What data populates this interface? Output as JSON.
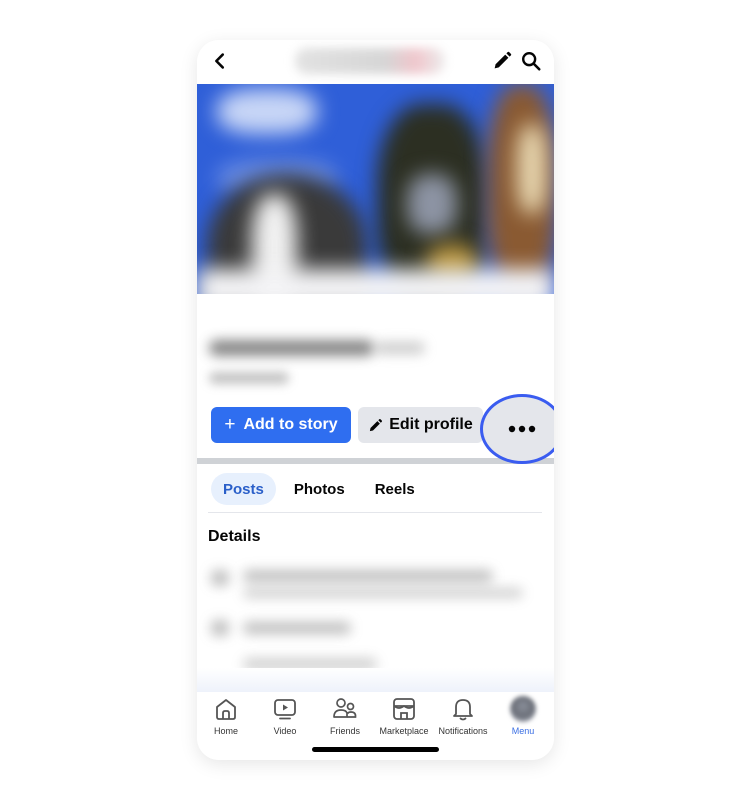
{
  "topbar": {
    "back_icon": "chevron-left-icon",
    "title": "",
    "edit_icon": "pencil-icon",
    "search_icon": "search-icon"
  },
  "profile": {
    "name": "",
    "subtitle": ""
  },
  "actions": {
    "add_to_story_label": "Add to story",
    "add_to_story_icon": "plus-icon",
    "edit_profile_label": "Edit profile",
    "edit_profile_icon": "pencil-icon",
    "more_icon": "more-horizontal-icon",
    "highlight_color": "#3a5cf0",
    "primary_color": "#2f6ef0"
  },
  "tabs": [
    {
      "label": "Posts",
      "active": true
    },
    {
      "label": "Photos",
      "active": false
    },
    {
      "label": "Reels",
      "active": false
    }
  ],
  "details": {
    "title": "Details"
  },
  "bottom_nav": [
    {
      "label": "Home",
      "icon": "home-icon",
      "active": false
    },
    {
      "label": "Video",
      "icon": "video-icon",
      "active": false
    },
    {
      "label": "Friends",
      "icon": "friends-icon",
      "active": false
    },
    {
      "label": "Marketplace",
      "icon": "marketplace-icon",
      "active": false
    },
    {
      "label": "Notifications",
      "icon": "bell-icon",
      "active": false
    },
    {
      "label": "Menu",
      "icon": "avatar",
      "active": true
    }
  ]
}
